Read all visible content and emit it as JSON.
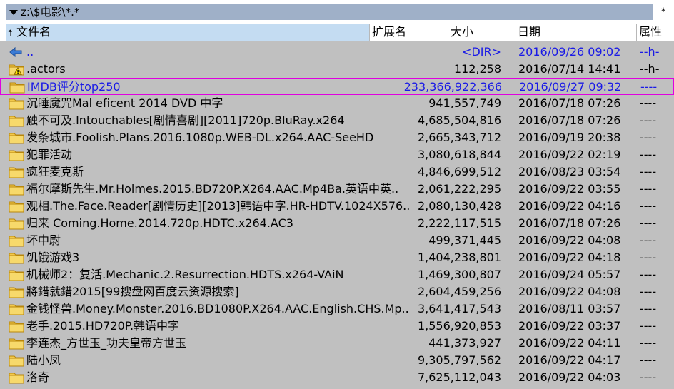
{
  "path": {
    "text": "z:\\$电影\\*.*",
    "star": "*"
  },
  "header": {
    "name": "文件名",
    "ext": "扩展名",
    "size": "大小",
    "date": "日期",
    "attr": "属性"
  },
  "colors": {
    "highlight": "#1a1ae6",
    "focus_border": "#e000e0",
    "background": "#c0c0c0"
  },
  "rows": [
    {
      "icon": "up-arrow-icon",
      "name": "..",
      "size": "<DIR>",
      "date": "2016/09/26 09:02",
      "attr": "--h-",
      "blue": true
    },
    {
      "icon": "warning-folder-icon",
      "name": ".actors",
      "size": "112,258",
      "date": "2016/07/14 14:41",
      "attr": "--h-",
      "blue": false
    },
    {
      "icon": "folder-icon",
      "name": "IMDB评分top250",
      "size": "233,366,922,366",
      "date": "2016/09/27 09:32",
      "attr": "----",
      "blue": true,
      "focused": true
    },
    {
      "icon": "folder-icon",
      "name": "沉睡魔咒Mal eficent 2014 DVD 中字",
      "size": "941,557,749",
      "date": "2016/07/18 07:26",
      "attr": "----"
    },
    {
      "icon": "folder-icon",
      "name": "触不可及.Intouchables[剧情喜剧][2011]720p.BluRay.x264",
      "size": "4,685,504,816",
      "date": "2016/07/18 07:26",
      "attr": "----"
    },
    {
      "icon": "folder-icon",
      "name": "发条城市.Foolish.Plans.2016.1080p.WEB-DL.x264.AAC-SeeHD",
      "size": "2,665,343,712",
      "date": "2016/09/19 20:38",
      "attr": "----"
    },
    {
      "icon": "folder-icon",
      "name": "犯罪活动",
      "size": "3,080,618,844",
      "date": "2016/09/22 02:19",
      "attr": "----"
    },
    {
      "icon": "folder-icon",
      "name": "疯狂麦克斯",
      "size": "4,846,699,512",
      "date": "2016/08/23 03:54",
      "attr": "----"
    },
    {
      "icon": "folder-icon",
      "name": "福尔摩斯先生.Mr.Holmes.2015.BD720P.X264.AAC.Mp4Ba.英语中英..",
      "size": "2,061,222,295",
      "date": "2016/09/22 03:55",
      "attr": "----"
    },
    {
      "icon": "folder-icon",
      "name": "观相.The.Face.Reader[剧情历史][2013]韩语中字.HR-HDTV.1024X576..",
      "size": "2,080,130,428",
      "date": "2016/09/22 04:16",
      "attr": "----"
    },
    {
      "icon": "folder-icon",
      "name": "归来 Coming.Home.2014.720p.HDTC.x264.AC3",
      "size": "2,222,117,515",
      "date": "2016/07/18 07:26",
      "attr": "----"
    },
    {
      "icon": "folder-icon",
      "name": "坏中尉",
      "size": "499,371,445",
      "date": "2016/09/22 04:08",
      "attr": "----"
    },
    {
      "icon": "folder-icon",
      "name": "饥饿游戏3",
      "size": "1,404,238,801",
      "date": "2016/09/22 04:18",
      "attr": "----"
    },
    {
      "icon": "folder-icon",
      "name": "机械师2：复活.Mechanic.2.Resurrection.HDTS.x264-VAiN",
      "size": "1,469,300,807",
      "date": "2016/09/24 05:57",
      "attr": "----"
    },
    {
      "icon": "folder-icon",
      "name": "將錯就錯2015[99搜盘网百度云资源搜索]",
      "size": "2,604,459,256",
      "date": "2016/09/22 04:08",
      "attr": "----"
    },
    {
      "icon": "folder-icon",
      "name": "金钱怪兽.Money.Monster.2016.BD1080P.X264.AAC.English.CHS.Mp..",
      "size": "3,641,417,543",
      "date": "2016/08/11 03:57",
      "attr": "----"
    },
    {
      "icon": "folder-icon",
      "name": "老手.2015.HD720P.韩语中字",
      "size": "1,556,920,853",
      "date": "2016/09/22 03:37",
      "attr": "----"
    },
    {
      "icon": "folder-icon",
      "name": "李连杰_方世玉_功夫皇帝方世玉",
      "size": "441,373,927",
      "date": "2016/09/22 04:11",
      "attr": "----"
    },
    {
      "icon": "folder-icon",
      "name": "陆小凤",
      "size": "9,305,797,562",
      "date": "2016/09/22 04:17",
      "attr": "----"
    },
    {
      "icon": "folder-icon",
      "name": "洛奇",
      "size": "7,625,112,043",
      "date": "2016/09/22 04:03",
      "attr": "----"
    }
  ]
}
